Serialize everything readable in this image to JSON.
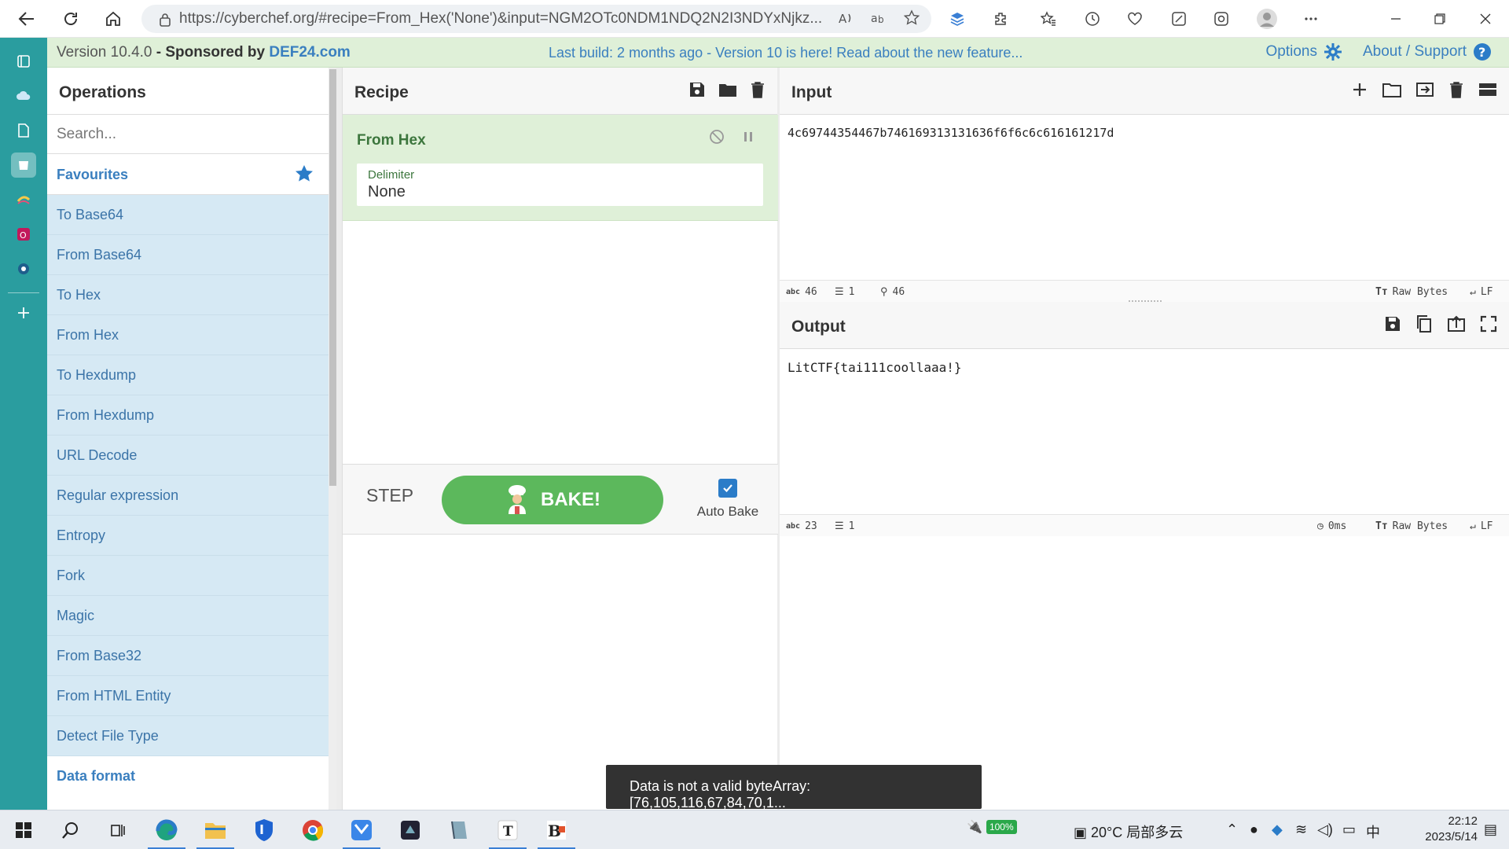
{
  "browser": {
    "url": "https://cyberchef.org/#recipe=From_Hex('None')&input=NGM2OTc0NDM1NDQ2N2I3NDYxNjkz..."
  },
  "banner": {
    "version": "Version 10.4.0",
    "sponsored_prefix": "Sponsored by",
    "sponsor": "DEF24.com",
    "build_note": "Last build: 2 months ago - Version 10 is here! Read about the new feature...",
    "options_label": "Options",
    "about_label": "About / Support"
  },
  "operations": {
    "title": "Operations",
    "search_placeholder": "Search...",
    "favourites_label": "Favourites",
    "items": [
      {
        "label": "To Base64"
      },
      {
        "label": "From Base64"
      },
      {
        "label": "To Hex"
      },
      {
        "label": "From Hex"
      },
      {
        "label": "To Hexdump"
      },
      {
        "label": "From Hexdump"
      },
      {
        "label": "URL Decode"
      },
      {
        "label": "Regular expression"
      },
      {
        "label": "Entropy"
      },
      {
        "label": "Fork"
      },
      {
        "label": "Magic"
      },
      {
        "label": "From Base32"
      },
      {
        "label": "From HTML Entity"
      },
      {
        "label": "Detect File Type"
      }
    ],
    "category_label": "Data format"
  },
  "recipe": {
    "title": "Recipe",
    "operation": {
      "name": "From Hex",
      "arg_label": "Delimiter",
      "arg_value": "None"
    },
    "step_label": "STEP",
    "bake_label": "BAKE!",
    "autobake_label": "Auto Bake",
    "autobake_checked": true
  },
  "input": {
    "title": "Input",
    "text": "4c69744354467b746169313131636f6f6c6c616161217d",
    "length": "46",
    "lines": "1",
    "cursor": "46",
    "encoding": "Raw Bytes",
    "eol": "LF"
  },
  "output": {
    "title": "Output",
    "text": "LitCTF{tai111coollaaa!}",
    "length": "23",
    "lines": "1",
    "time": "0ms",
    "encoding": "Raw Bytes",
    "eol": "LF"
  },
  "toast": {
    "message": "Data is not a valid byteArray: [76,105,116,67,84,70,1..."
  },
  "taskbar": {
    "battery": "100%",
    "weather": "20°C 局部多云",
    "ime": "中",
    "time": "22:12",
    "date": "2023/5/14"
  },
  "colors": {
    "edge_sidebar": "#2a9d9f",
    "banner_bg": "#dff0d8",
    "op_item_bg": "#d6e9f4",
    "bake_button": "#5cb85c",
    "link_blue": "#3a7fbf"
  }
}
